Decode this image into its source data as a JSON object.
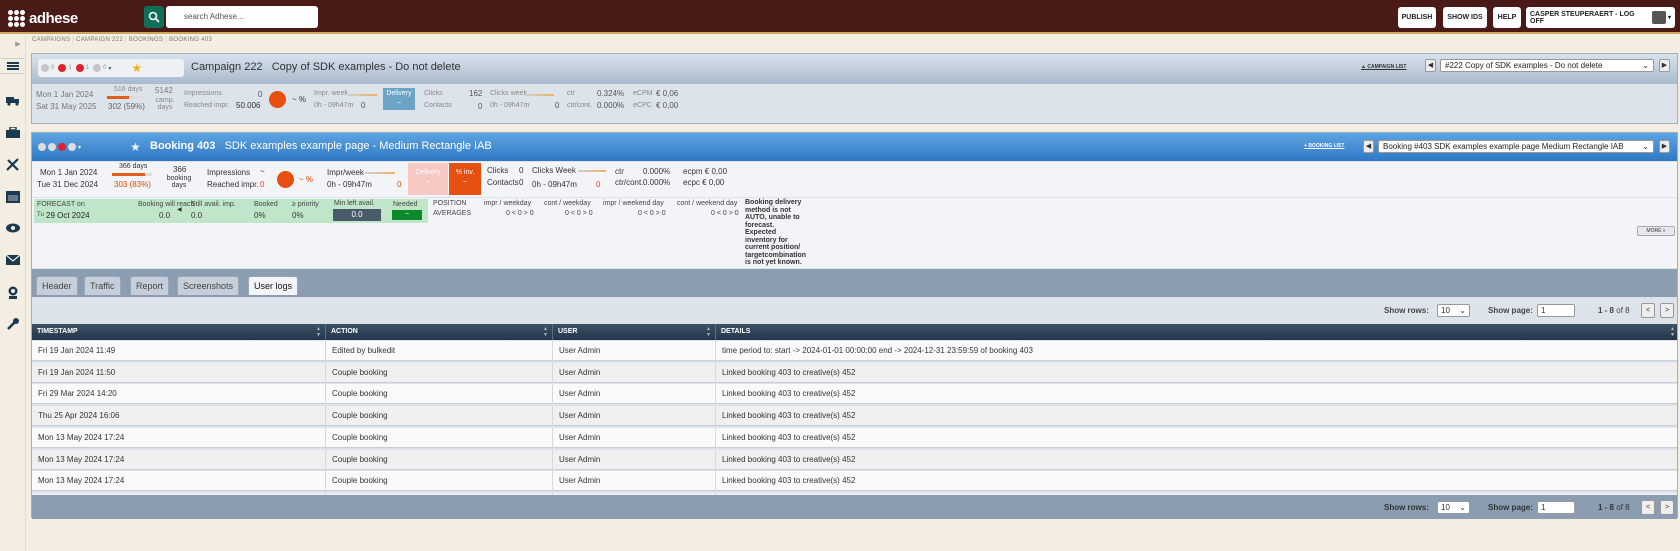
{
  "app": {
    "logo_text": "adhese"
  },
  "search": {
    "placeholder": "search Adhese..."
  },
  "top_buttons": {
    "publish": "PUBLISH",
    "show_ids": "SHOW IDS",
    "help": "HELP",
    "user": "CASPER STEUPERAERT - LOG OFF"
  },
  "breadcrumb": [
    "CAMPAIGNS",
    "CAMPAIGN 222",
    "BOOKINGS",
    "BOOKING 403"
  ],
  "campaign": {
    "status_counts": [
      "0",
      "1",
      "1",
      "0"
    ],
    "label": "Campaign 222",
    "name": "Copy of SDK examples - Do not delete",
    "list_link": "CAMPAIGN LIST",
    "selector": "#222 Copy of SDK examples - Do not delete",
    "start": "Mon 1 Jan 2024",
    "end": "Sat 31 May 2025",
    "total_days": "516 days",
    "elapsed": "302 (59%)",
    "camp_days_value": "5142",
    "camp_days_label": "camp. days",
    "impressions_label": "Impressions",
    "impressions_value": "0",
    "reached_label": "Reached impr.",
    "reached_value": "50.006",
    "pct": "~ %",
    "impr_week_label": "Impr. week",
    "impr_week_time": "0h - 09h47m",
    "impr_week_value": "0",
    "delivery_label": "Delivery",
    "delivery_value": "~",
    "clicks_label": "Clicks",
    "clicks_value": "162",
    "contacts_label": "Contacts",
    "contacts_value": "0",
    "clicks_week_label": "Clicks week",
    "clicks_week_time": "0h - 09h47m",
    "clicks_week_value": "0",
    "ctr_label": "ctr",
    "ctr_value": "0.324%",
    "ctrcont_label": "ctr/cont.",
    "ctrcont_value": "0.000%",
    "ecpm_label": "eCPM",
    "ecpm_value": "€ 0,06",
    "ecpc_label": "eCPC",
    "ecpc_value": "€ 0,00"
  },
  "booking": {
    "label": "Booking 403",
    "name": "SDK examples example page - Medium Rectangle IAB",
    "list_link": "BOOKING LIST",
    "selector": "Booking #403 SDK examples example page Medium Rectangle IAB",
    "start": "Mon 1 Jan 2024",
    "end": "Tue 31 Dec 2024",
    "total_days": "366 days",
    "elapsed": "303 (83%)",
    "booking_days_value": "366",
    "booking_days_label": "booking days",
    "impressions_label": "Impressions",
    "impressions_value": "~",
    "reached_label": "Reached impr.",
    "reached_value": "0",
    "pct": "~ %",
    "impr_week_label": "Impr/week",
    "impr_week_time": "0h - 09h47m",
    "impr_week_value": "0",
    "delivery_label": "Delivery",
    "delivery_value": "~",
    "pct_inv_label": "% inv.",
    "pct_inv_value": "~",
    "clicks_label": "Clicks",
    "clicks_value": "0",
    "contacts_label": "Contacts",
    "contacts_value": "0",
    "clicks_week_label": "Clicks Week",
    "clicks_week_time": "0h - 09h47m",
    "clicks_week_value": "0",
    "ctr_label": "ctr",
    "ctr_value": "0.000%",
    "ctrcont_label": "ctr/cont.",
    "ctrcont_value": "0.000%",
    "ecpm": "ecpm € 0,00",
    "ecpc": "ecpc € 0,00"
  },
  "forecast": {
    "label": "FORECAST on",
    "day": "Tu",
    "date": "29 Oct 2024",
    "will_reach_label": "Booking will reach",
    "will_reach_value": "0.0",
    "still_avail_label": "Still avail. imp.",
    "still_avail_value": "0.0",
    "booked_label": "Booked",
    "booked_value": "0%",
    "priority_label": "≥ priority",
    "priority_value": "0%",
    "min_left_label": "Min left avail.",
    "min_left_value": "0.0",
    "needed_label": "Needed",
    "needed_value": "~",
    "position_label": "POSITION",
    "averages_label": "AVERAGES",
    "cols": [
      {
        "label": "impr / weekday",
        "value": "0 < 0 > 0"
      },
      {
        "label": "cont / weekday",
        "value": "0 < 0 > 0"
      },
      {
        "label": "impr / weekend day",
        "value": "0 < 0 > 0"
      },
      {
        "label": "cont / weekend day",
        "value": "0 < 0 > 0"
      }
    ],
    "note_lines": [
      "Booking delivery",
      "method is not",
      "AUTO, unable to",
      "forecast.",
      "Expected",
      "inventory for",
      "current position/",
      "targetcombination",
      "is not yet known."
    ],
    "more": "MORE »"
  },
  "tabs": [
    "Header",
    "Traffic",
    "Report",
    "Screenshots",
    "User logs"
  ],
  "pager": {
    "show_rows_label": "Show rows:",
    "rows": "10",
    "show_page_label": "Show page:",
    "page": "1",
    "range": "1 - 8",
    "of": "of 8",
    "prev": "<",
    "next": ">"
  },
  "table": {
    "headers": [
      "TIMESTAMP",
      "ACTION",
      "USER",
      "DETAILS"
    ],
    "rows": [
      [
        "Fri 19 Jan 2024 11:49",
        "Edited by bulkedit",
        "User Admin",
        "time period to: start -> 2024-01-01 00:00:00 end -> 2024-12-31 23:59:59 of booking 403"
      ],
      [
        "Fri 19 Jan 2024 11:50",
        "Couple booking",
        "User Admin",
        "Linked booking 403 to creative(s) 452"
      ],
      [
        "Fri 29 Mar 2024 14:20",
        "Couple booking",
        "User Admin",
        "Linked booking 403 to creative(s) 452"
      ],
      [
        "Thu 25 Apr 2024 16:06",
        "Couple booking",
        "User Admin",
        "Linked booking 403 to creative(s) 452"
      ],
      [
        "Mon 13 May 2024 17:24",
        "Couple booking",
        "User Admin",
        "Linked booking 403 to creative(s) 452"
      ],
      [
        "Mon 13 May 2024 17:24",
        "Couple booking",
        "User Admin",
        "Linked booking 403 to creative(s) 452"
      ],
      [
        "Mon 13 May 2024 17:24",
        "Couple booking",
        "User Admin",
        "Linked booking 403 to creative(s) 452"
      ],
      [
        "Wed 22 May 2024 10:38",
        "Couple booking",
        "User Admin",
        "Linked booking 403 to creative(s) 452"
      ]
    ]
  },
  "colors": {
    "header_bg": "#4a1a17",
    "booking_blue": "#3a86d2",
    "delivery_cyan": "#6ba4c4",
    "orange": "#e75010",
    "forecast_green": "#bfe6c9"
  }
}
